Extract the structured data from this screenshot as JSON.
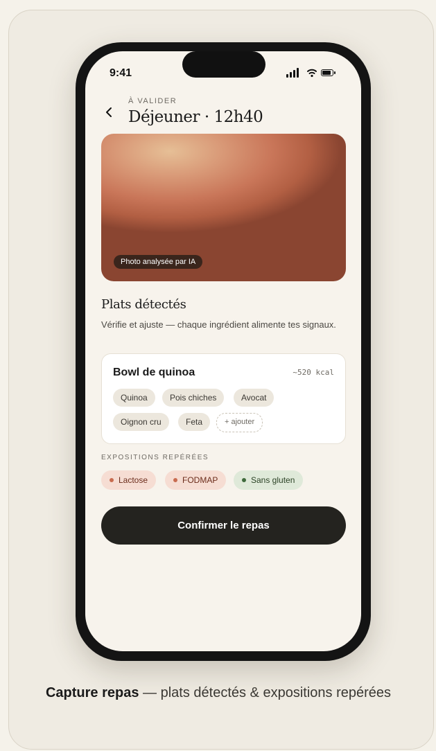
{
  "status_bar": {
    "time": "9:41"
  },
  "header": {
    "eyebrow": "À VALIDER",
    "title": "Déjeuner · 12h40",
    "back_icon": "chevron-left-icon"
  },
  "photo": {
    "badge": "Photo analysée par IA"
  },
  "detected": {
    "title": "Plats détectés",
    "subtitle": "Vérifie et ajuste — chaque ingrédient alimente tes signaux."
  },
  "dish": {
    "name": "Bowl de quinoa",
    "kcal": "~520 kcal",
    "ingredients": [
      "Quinoa",
      "Pois chiches",
      "Avocat",
      "Oignon cru",
      "Feta"
    ],
    "add_label": "+ ajouter"
  },
  "expositions": {
    "label": "EXPOSITIONS REPÉRÉES",
    "tags": [
      {
        "label": "Lactose",
        "status": "warning",
        "color": "#c86c50"
      },
      {
        "label": "FODMAP",
        "status": "warning",
        "color": "#c86c50"
      },
      {
        "label": "Sans gluten",
        "status": "ok",
        "color": "#3f6a3c"
      }
    ]
  },
  "cta": {
    "label": "Confirmer le repas"
  },
  "caption": {
    "bold": "Capture repas",
    "rest": " — plats détectés & expositions repérées"
  }
}
